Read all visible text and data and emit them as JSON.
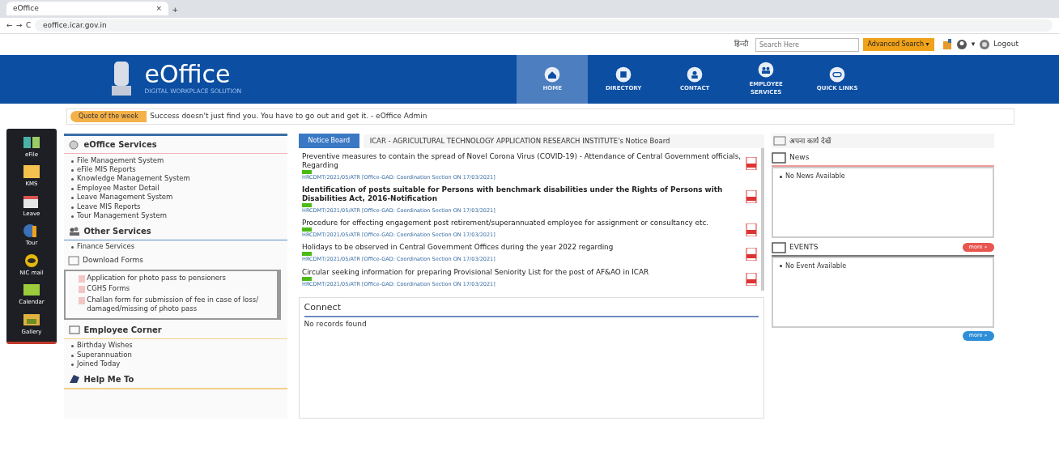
{
  "browser": {
    "tab_title": "eOffice",
    "close": "×",
    "new_tab": "+",
    "back": "←",
    "forward": "→",
    "reload": "C",
    "address": "eoffice.icar.gov.in"
  },
  "topbar": {
    "language": "हिन्दी",
    "search": {
      "placeholder": "Search Here"
    },
    "advanced_search": "Advanced Search ▾",
    "account_caret": "▾",
    "logout": "Logout"
  },
  "header": {
    "logo_title": "eOffice",
    "logo_subtitle": "DIGITAL WORKPLACE SOLUTION"
  },
  "nav": [
    {
      "label": "HOME",
      "selected": true
    },
    {
      "label": "DIRECTORY",
      "selected": false
    },
    {
      "label": "CONTACT",
      "selected": false
    },
    {
      "label": "EMPLOYEE SERVICES",
      "selected": false
    },
    {
      "label": "QUICK LINKS",
      "selected": false
    }
  ],
  "quote": {
    "label": "Quote of the week",
    "text": "Success doesn't just find you. You have to go out and get it. - eOffice Admin"
  },
  "sidebar": [
    {
      "label": "eFile"
    },
    {
      "label": "KMS"
    },
    {
      "label": "Leave"
    },
    {
      "label": "Tour"
    },
    {
      "label": "NIC mail"
    },
    {
      "label": "Calendar"
    },
    {
      "label": "Gallery"
    }
  ],
  "services": {
    "title": "eOffice Services",
    "items": [
      "File Management System",
      "eFile MIS Reports",
      "Knowledge Management System",
      "Employee Master Detail",
      "Leave Management System",
      "Leave MIS Reports",
      "Tour Management System"
    ]
  },
  "other_services": {
    "title": "Other Services",
    "items": [
      "Finance Services"
    ]
  },
  "download_forms": {
    "title": "Download Forms",
    "items": [
      "Application for photo pass to pensioners",
      "CGHS Forms",
      "Challan form for submission of fee in case of loss/ damaged/missing of photo pass"
    ]
  },
  "employee_corner": {
    "title": "Employee Corner",
    "items": [
      "Birthday Wishes",
      "Superannuation",
      "Joined Today"
    ]
  },
  "help": {
    "title": "Help Me To"
  },
  "notice_board": {
    "tab_label": "Notice Board",
    "title": "ICAR - AGRICULTURAL TECHNOLOGY APPLICATION RESEARCH INSTITUTE's Notice Board",
    "notices": [
      {
        "title": "Preventive measures to contain the spread of Novel Corona Virus (COVID-19) - Attendance of Central Government officials, Regarding",
        "meta": "HRCDMT/2021/05/ATR [Office-GAD: Coordination Section ON 17/03/2021]",
        "bold": false,
        "is_new": true
      },
      {
        "title": "Identification of posts suitable for Persons with benchmark disabilities under the Rights of Persons with Disabilities Act, 2016-Notification",
        "meta": "HRCDMT/2021/05/ATR [Office-GAD: Coordination Section ON 17/03/2021]",
        "bold": true,
        "is_new": true
      },
      {
        "title": "Procedure for effecting engagement post retirement/superannuated employee for assignment or consultancy etc.",
        "meta": "HRCDMT/2021/05/ATR [Office-GAD: Coordination Section ON 17/03/2021]",
        "bold": false,
        "is_new": true
      },
      {
        "title": "Holidays to be observed in Central Government Offices during the year 2022 regarding",
        "meta": "HRCDMT/2021/05/ATR [Office-GAD: Coordination Section ON 17/03/2021]",
        "bold": false,
        "is_new": true
      },
      {
        "title": "Circular seeking information for preparing Provisional Seniority List for the post of AF&AO in ICAR",
        "meta": "HRCDMT/2021/05/ATR [Office-GAD: Coordination Section ON 17/03/2021]",
        "bold": false,
        "is_new": true
      }
    ]
  },
  "connect": {
    "title": "Connect",
    "message": "No records found"
  },
  "right": {
    "apps_title": "अपना कार्य देखें",
    "news": {
      "title": "News",
      "items": [
        "No News Available"
      ]
    },
    "events": {
      "title": "EVENTS",
      "more": "more »",
      "items": [
        "No Event Available"
      ]
    },
    "more": "more »"
  }
}
